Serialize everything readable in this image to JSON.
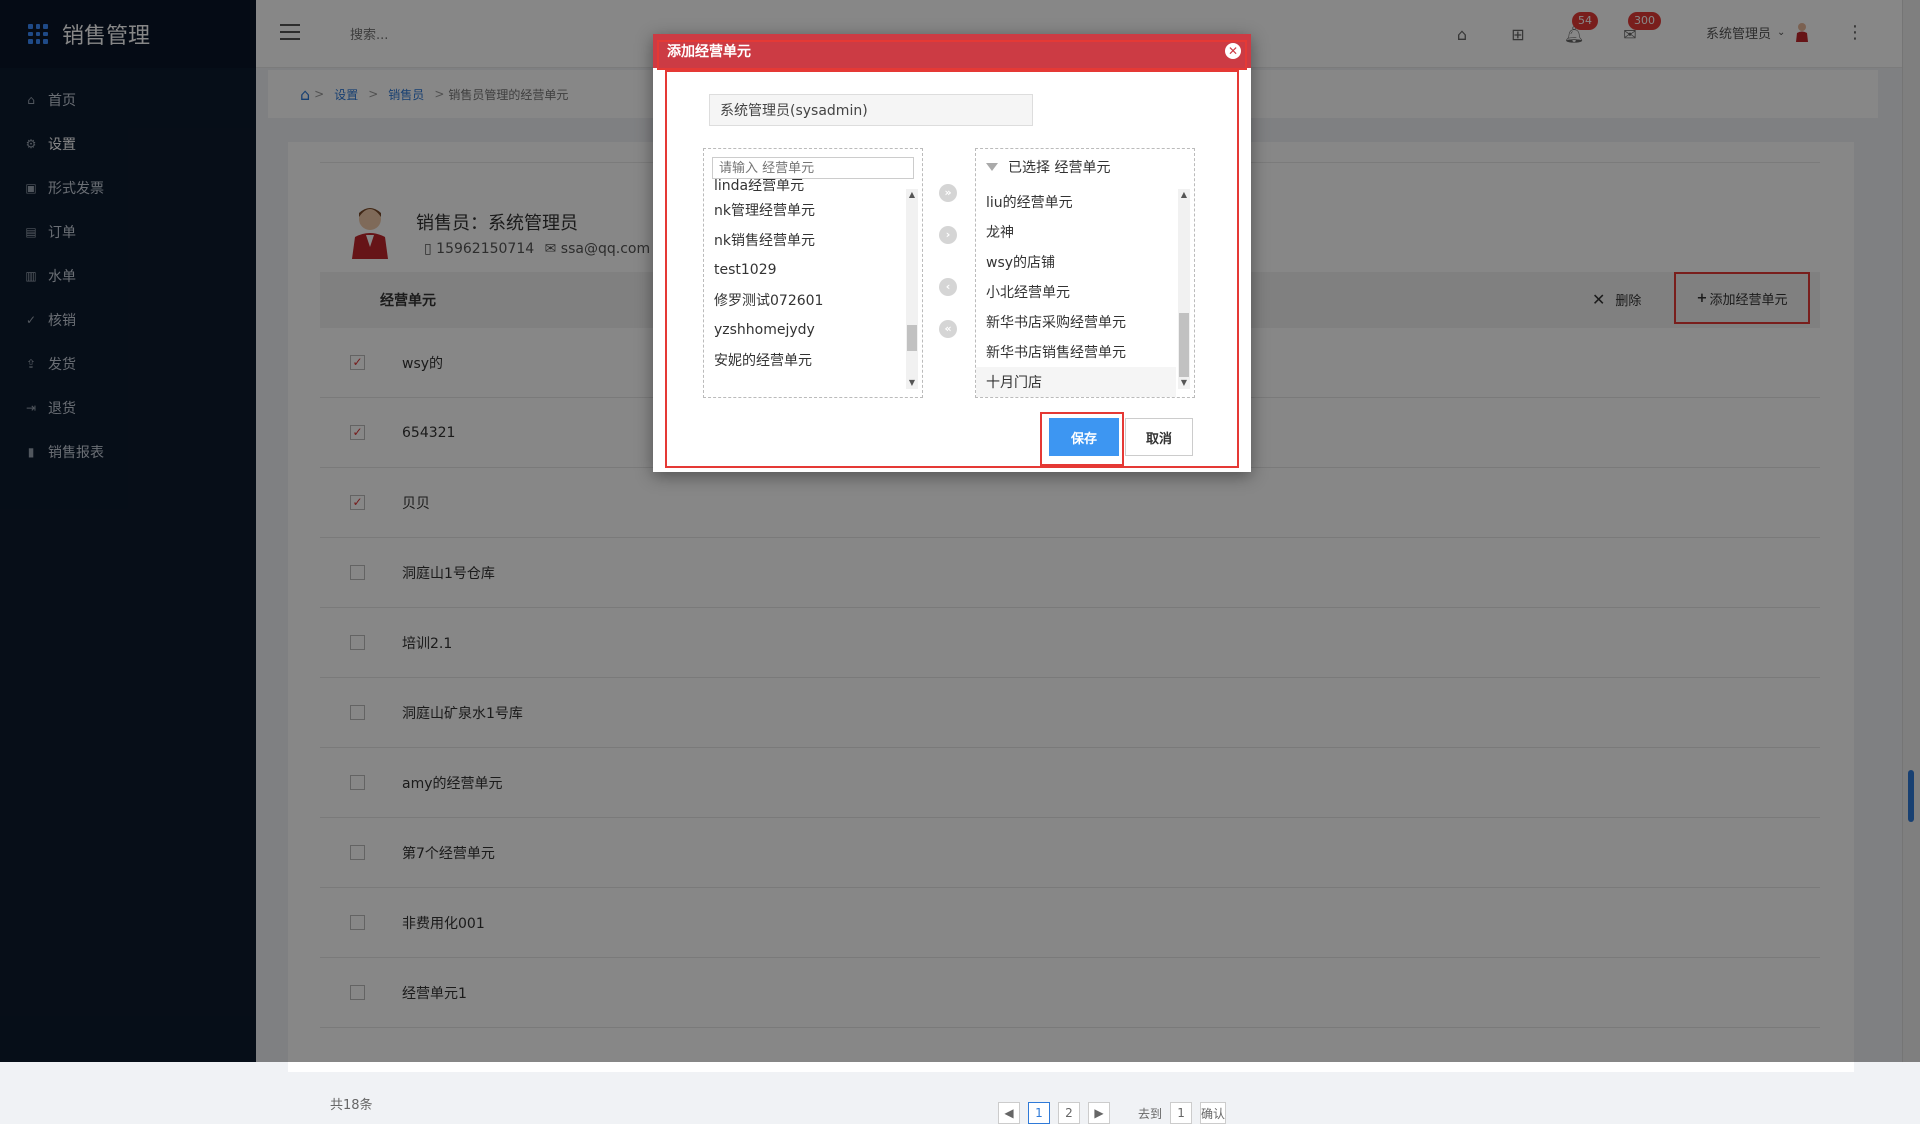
{
  "sidebar": {
    "title": "销售管理",
    "items": [
      {
        "label": "首页",
        "icon": "home-icon"
      },
      {
        "label": "设置",
        "icon": "gear-icon"
      },
      {
        "label": "形式发票",
        "icon": "invoice-icon"
      },
      {
        "label": "订单",
        "icon": "order-icon"
      },
      {
        "label": "水单",
        "icon": "receipt-icon"
      },
      {
        "label": "核销",
        "icon": "check-circle-icon"
      },
      {
        "label": "发货",
        "icon": "upload-icon"
      },
      {
        "label": "退货",
        "icon": "return-icon"
      },
      {
        "label": "销售报表",
        "icon": "bar-chart-icon"
      }
    ]
  },
  "topbar": {
    "search_placeholder": "搜索...",
    "notifications_count": "54",
    "messages_count": "300",
    "user_name": "系统管理员"
  },
  "breadcrumb": {
    "items": [
      "设置",
      "销售员"
    ],
    "current": "销售员管理的经营单元"
  },
  "profile": {
    "name": "销售员：系统管理员",
    "phone": "15962150714",
    "email": "ssa@qq.com"
  },
  "table": {
    "column_header": "经营单元",
    "delete_label": "删除",
    "add_label": "添加经营单元",
    "rows": [
      {
        "label": "wsy的",
        "checked": "✓"
      },
      {
        "label": "654321",
        "checked": "✓"
      },
      {
        "label": "贝贝",
        "checked": "✓"
      },
      {
        "label": "洞庭山1号仓库",
        "checked": ""
      },
      {
        "label": "培训2.1",
        "checked": ""
      },
      {
        "label": "洞庭山矿泉水1号库",
        "checked": ""
      },
      {
        "label": "amy的经营单元",
        "checked": ""
      },
      {
        "label": "第7个经营单元",
        "checked": ""
      },
      {
        "label": "非费用化001",
        "checked": ""
      },
      {
        "label": "经营单元1",
        "checked": ""
      }
    ],
    "total_label": "共18条"
  },
  "pagination": {
    "pages": [
      "1",
      "2"
    ],
    "goto_label": "去到",
    "goto_value": "1",
    "confirm_label": "确认"
  },
  "modal": {
    "title": "添加经营单元",
    "selected_user": "系统管理员(sysadmin)",
    "filter_placeholder": "请输入 经营单元",
    "available_items": [
      "linda经营单元",
      "nk管理经营单元",
      "nk销售经营单元",
      "test1029",
      "修罗测试072601",
      "yzshhomejydy",
      "安妮的经营单元"
    ],
    "selected_header": "已选择 经营单元",
    "selected_items": [
      "liu的经营单元",
      "龙神",
      "wsy的店铺",
      "小北经营单元",
      "新华书店采购经营单元",
      "新华书店销售经营单元",
      "十月门店"
    ],
    "save_label": "保存",
    "cancel_label": "取消"
  },
  "colors": {
    "sidebar_bg": "#0d1b2e",
    "accent_blue": "#3d96f2",
    "modal_header": "#cc3b44",
    "highlight_red": "#e53935"
  }
}
